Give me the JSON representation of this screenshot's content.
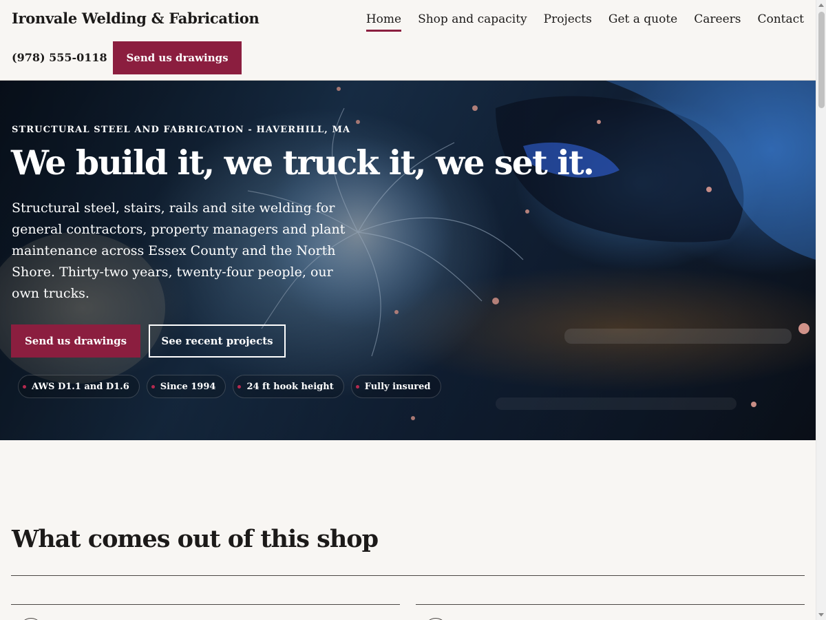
{
  "header": {
    "brand": "Ironvale Welding & Fabrication",
    "nav": [
      {
        "label": "Home",
        "active": true
      },
      {
        "label": "Shop and capacity",
        "active": false
      },
      {
        "label": "Projects",
        "active": false
      },
      {
        "label": "Get a quote",
        "active": false
      },
      {
        "label": "Careers",
        "active": false
      },
      {
        "label": "Contact",
        "active": false
      }
    ],
    "phone": "(978) 555-0118",
    "cta": "Send us drawings"
  },
  "hero": {
    "eyebrow": "STRUCTURAL STEEL AND FABRICATION - HAVERHILL, MA",
    "title": "We build it, we truck it, we set it.",
    "lede": "Structural steel, stairs, rails and site welding for general contractors, property managers and plant maintenance across Essex County and the North Shore. Thirty-two years, twenty-four people, our own trucks.",
    "primary_button": "Send us drawings",
    "secondary_button": "See recent projects",
    "badges": [
      "AWS D1.1 and D1.6",
      "Since 1994",
      "24 ft hook height",
      "Fully insured"
    ],
    "image_icon": "welding-sparks-photo"
  },
  "section": {
    "title": "What comes out of this shop"
  },
  "colors": {
    "accent": "#8b1e3f",
    "background": "#f8f6f3",
    "text": "#1c1a19"
  }
}
